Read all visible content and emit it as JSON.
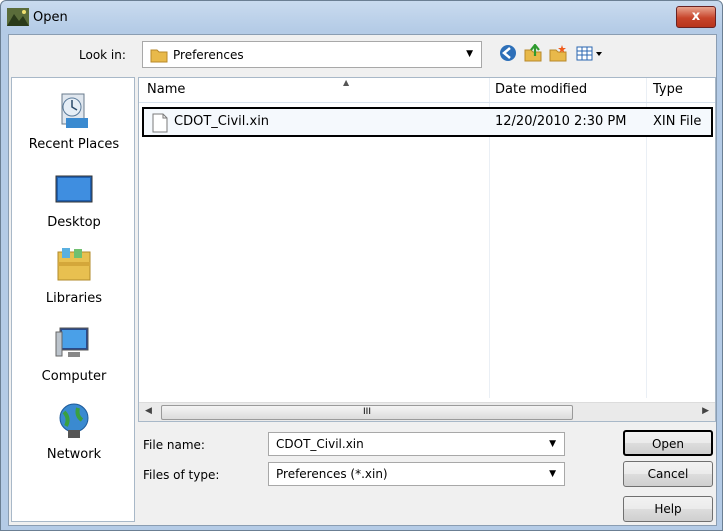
{
  "window": {
    "title": "Open",
    "close_label": "x"
  },
  "toolbar": {
    "look_in_label": "Look in:",
    "look_in_value": "Preferences",
    "icons": [
      "back-icon",
      "up-folder-icon",
      "new-folder-icon",
      "view-menu-icon"
    ]
  },
  "places": [
    {
      "label": "Recent Places",
      "icon": "recent-places-icon"
    },
    {
      "label": "Desktop",
      "icon": "desktop-icon"
    },
    {
      "label": "Libraries",
      "icon": "libraries-icon"
    },
    {
      "label": "Computer",
      "icon": "computer-icon"
    },
    {
      "label": "Network",
      "icon": "network-icon"
    }
  ],
  "file_list": {
    "columns": [
      "Name",
      "Date modified",
      "Type"
    ],
    "rows": [
      {
        "name": "CDOT_Civil.xin",
        "date_modified": "12/20/2010 2:30 PM",
        "type": "XIN File"
      }
    ],
    "scroll_thumb": "III"
  },
  "fields": {
    "file_name_label": "File name:",
    "file_name_value": "CDOT_Civil.xin",
    "file_type_label": "Files of type:",
    "file_type_value": "Preferences (*.xin)"
  },
  "buttons": {
    "open": "Open",
    "cancel": "Cancel",
    "help": "Help"
  },
  "colors": {
    "close": "#c7452b",
    "titlebar": "#c9dbef",
    "selection": "#000000"
  }
}
